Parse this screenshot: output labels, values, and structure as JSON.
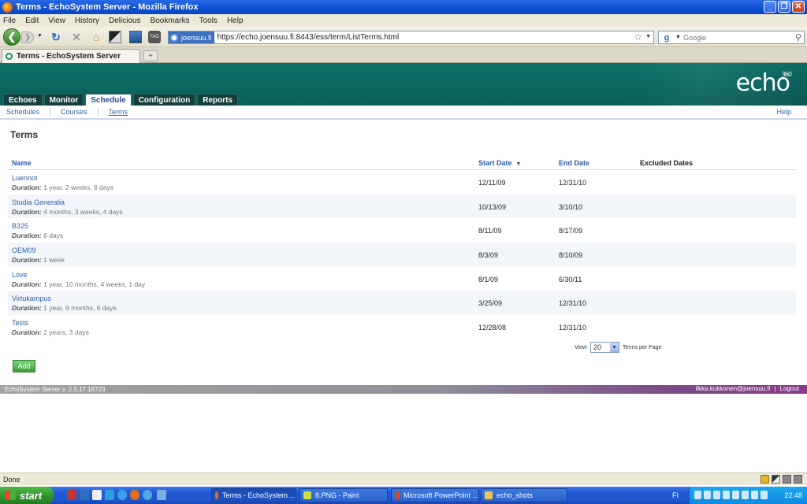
{
  "window": {
    "title": "Terms - EchoSystem Server - Mozilla Firefox"
  },
  "menu": [
    "File",
    "Edit",
    "View",
    "History",
    "Delicious",
    "Bookmarks",
    "Tools",
    "Help"
  ],
  "browser": {
    "site_identity": "joensuu.fi",
    "url": "https://echo.joensuu.fi:8443/ess/term/ListTerms.html",
    "search_placeholder": "Google",
    "tab_title": "Terms - EchoSystem Server",
    "new_tab": "+",
    "status": "Done"
  },
  "app": {
    "logo": "echo",
    "logo_sup": "360",
    "main_tabs": [
      "Echoes",
      "Monitor",
      "Schedule",
      "Configuration",
      "Reports"
    ],
    "active_tab": "Schedule",
    "sub_nav": [
      "Schedules",
      "Courses",
      "Terms"
    ],
    "active_sub": "Terms",
    "help": "Help"
  },
  "page": {
    "title": "Terms",
    "columns": {
      "name": "Name",
      "start": "Start Date",
      "end": "End Date",
      "excluded": "Excluded Dates"
    },
    "sorted_by": "Start Date",
    "duration_label": "Duration:",
    "rows": [
      {
        "name": "Luennot",
        "duration": "1 year, 2 weeks, 6 days",
        "start": "12/11/09",
        "end": "12/31/10"
      },
      {
        "name": "Studia Generalia",
        "duration": "4 months, 3 weeks, 4 days",
        "start": "10/13/09",
        "end": "3/10/10"
      },
      {
        "name": "B325",
        "duration": "6 days",
        "start": "8/11/09",
        "end": "8/17/09"
      },
      {
        "name": "OEM09",
        "duration": "1 week",
        "start": "8/3/09",
        "end": "8/10/09"
      },
      {
        "name": "Love",
        "duration": "1 year, 10 months, 4 weeks, 1 day",
        "start": "8/1/09",
        "end": "6/30/11"
      },
      {
        "name": "Virtukampus",
        "duration": "1 year, 9 months, 6 days",
        "start": "3/25/09",
        "end": "12/31/10"
      },
      {
        "name": "Tests",
        "duration": "2 years, 3 days",
        "start": "12/28/08",
        "end": "12/31/10"
      }
    ],
    "view_label": "View:",
    "view_value": "20",
    "per_page_label": "Terms per Page",
    "add_button": "Add"
  },
  "footer": {
    "version": "EchoSystem Server v. 2.5.17.16723",
    "user": "ilkka.kukkonen@joensuu.fi",
    "separator": "|",
    "logout": "Logout"
  },
  "taskbar": {
    "start": "start",
    "items": [
      "Terms - EchoSystem ...",
      "8.PNG - Paint",
      "Microsoft PowerPoint ...",
      "echo_shots"
    ],
    "language": "FI",
    "clock": "22:48"
  },
  "colors": {
    "header_teal": "#0d7268",
    "link_blue": "#2a5ea8",
    "add_green": "#3a9e3a"
  }
}
